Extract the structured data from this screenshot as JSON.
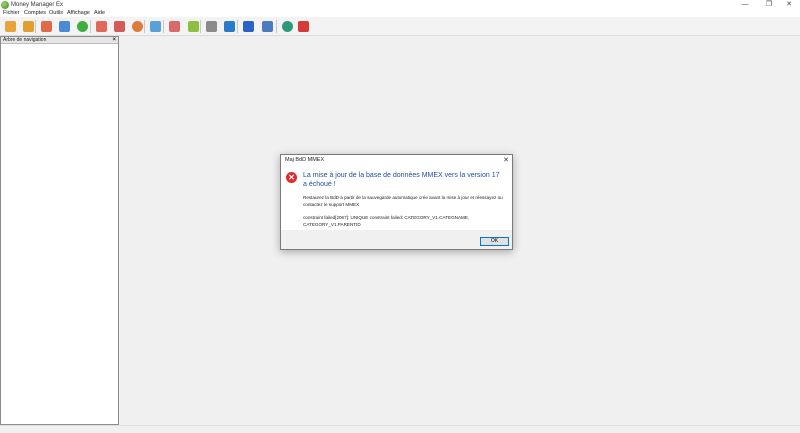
{
  "window": {
    "title": "Money Manager Ex",
    "controls": {
      "minimize": "—",
      "maximize": "❐",
      "close": "✕"
    }
  },
  "menu": {
    "items": [
      "Fichier",
      "Comptes",
      "Outils",
      "Affichage",
      "Aide"
    ]
  },
  "toolbar": {
    "icons": [
      "menu-list-icon",
      "folder-open-icon",
      "address-book-icon",
      "home-icon",
      "add-icon",
      "tag-icon",
      "user-icon",
      "info-circle-icon",
      "filter-icon",
      "edit-pencil-icon",
      "gear-icon",
      "printer-icon",
      "transfer-icon",
      "fullscreen-icon",
      "print-icon",
      "info-icon",
      "help-lifebuoy-icon"
    ],
    "colors": [
      "#e8a33c",
      "#e0a030",
      "#e06a4a",
      "#4b8ad6",
      "#3fae3f",
      "#e06a5a",
      "#d45a5a",
      "#e07a3a",
      "#5aa0d8",
      "#d86a6a",
      "#8fbf3f",
      "#8a8a8a",
      "#2a7acc",
      "#2a62c8",
      "#4b7ac0",
      "#2a9a7a",
      "#d83a3a"
    ]
  },
  "nav_panel": {
    "title": "Arbre de navigation",
    "close": "×"
  },
  "dialog": {
    "title": "Maj BdD MMEX",
    "close": "✕",
    "icon": "error-icon",
    "icon_glyph": "✕",
    "icon_color": "#e02b2b",
    "heading": "La mise à jour de la base de données MMEX vers la version 17 a échoué !",
    "line1": "Restaurez la BdD à partir de la sauvegarde automatique crée avant la mise à jour et réessayez ou contactez le support MMEX",
    "line2": "constraint failed[2067]: UNIQUE constraint failed: CATEGORY_V1.CATEGNAME, CATEGORY_V1.PARENTID",
    "ok_label": "OK"
  }
}
